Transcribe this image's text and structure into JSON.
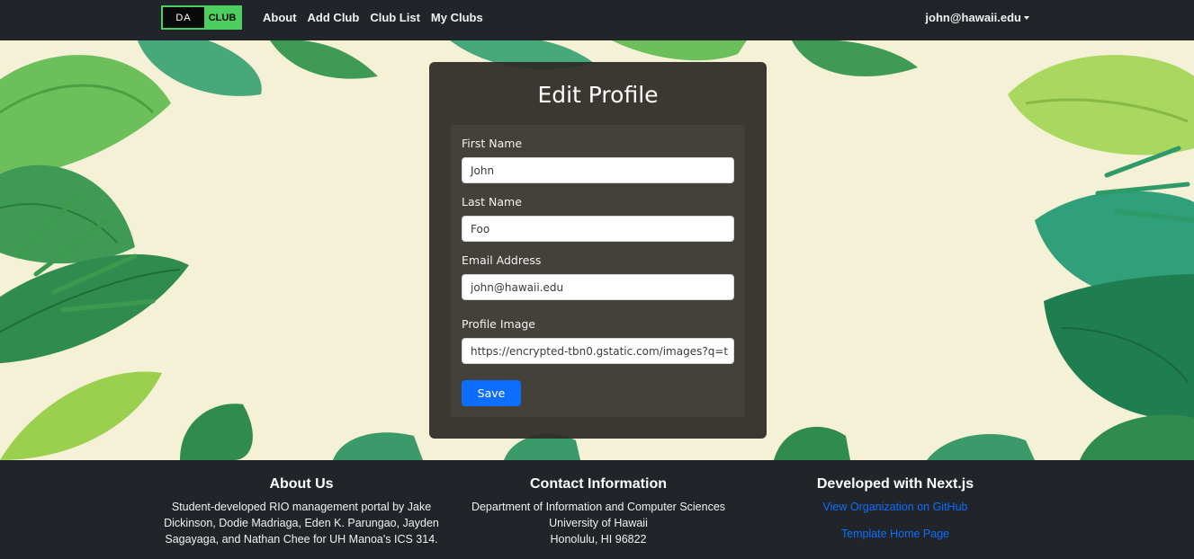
{
  "nav": {
    "logo_left": "DA",
    "logo_right": "CLUB",
    "links": [
      "About",
      "Add Club",
      "Club List",
      "My Clubs"
    ],
    "user": "john@hawaii.edu"
  },
  "form": {
    "title": "Edit Profile",
    "first_name_label": "First Name",
    "first_name_value": "John",
    "last_name_label": "Last Name",
    "last_name_value": "Foo",
    "email_label": "Email Address",
    "email_value": "john@hawaii.edu",
    "image_label": "Profile Image",
    "image_value": "https://encrypted-tbn0.gstatic.com/images?q=t",
    "save_label": "Save"
  },
  "footer": {
    "about_title": "About Us",
    "about_lines": [
      "Student-developed RIO management portal by Jake",
      "Dickinson, Dodie Madriaga, Eden K. Parungao, Jayden",
      "Sagayaga, and Nathan Chee for UH Manoa's ICS 314."
    ],
    "contact_title": "Contact Information",
    "contact_lines": [
      "Department of Information and Computer Sciences",
      "University of Hawaii",
      "Honolulu, HI 96822"
    ],
    "dev_title": "Developed with Next.js",
    "github_link": "View Organization on GitHub",
    "template_link": "Template Home Page"
  },
  "colors": {
    "navbar": "#212529",
    "accent_green": "#4ccf5e",
    "primary_blue": "#0d6efd",
    "hero_bg": "#f5f1d6"
  }
}
